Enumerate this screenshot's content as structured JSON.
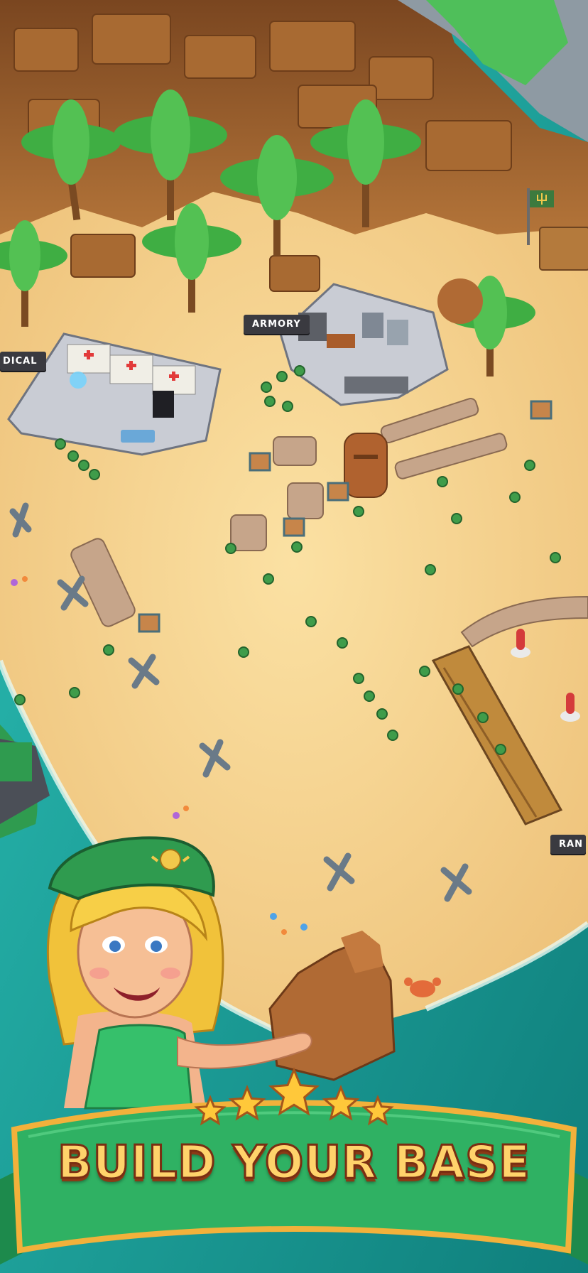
{
  "headline": "BUILD YOUR BASE",
  "signs": {
    "armory": "ARMORY",
    "medical": "DICAL",
    "ranks": "RAN"
  },
  "rating": {
    "stars": 5,
    "max": 5
  },
  "colors": {
    "sand": "#f6d28a",
    "sea": "#17a3a0",
    "cliff": "#9c5f2c",
    "palm": "#3fae43",
    "banner_green": "#2fb163",
    "banner_gold": "#f2b13b",
    "headline_fill": "#ffd36b",
    "headline_stroke": "#7a2e12"
  },
  "icons": [
    "medical-cross-icon",
    "trident-flag-icon",
    "star-icon",
    "crab-icon",
    "beret-emblem-icon"
  ]
}
